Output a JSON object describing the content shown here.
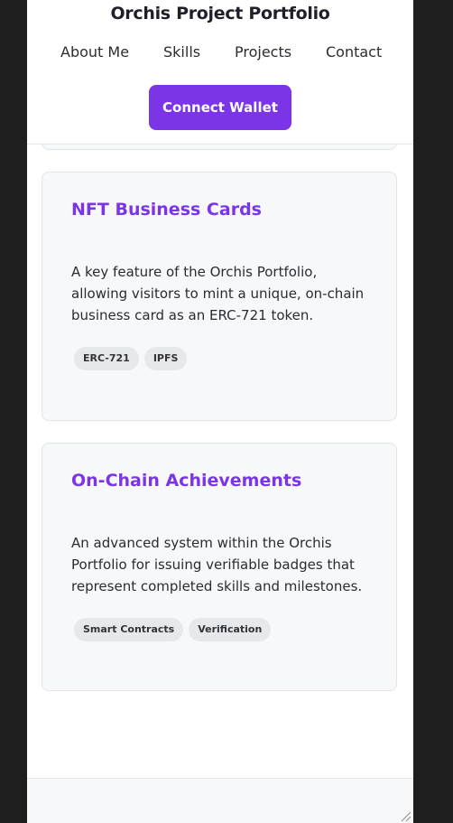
{
  "header": {
    "title": "Orchis Project Portfolio",
    "nav": [
      {
        "label": "About Me"
      },
      {
        "label": "Skills"
      },
      {
        "label": "Projects"
      },
      {
        "label": "Contact"
      }
    ],
    "connect_label": "Connect Wallet"
  },
  "projects": [
    {
      "title": "NFT Business Cards",
      "description": "A key feature of the Orchis Portfolio, allowing visitors to mint a unique, on-chain business card as an ERC-721 token.",
      "tags": [
        "ERC-721",
        "IPFS"
      ]
    },
    {
      "title": "On-Chain Achievements",
      "description": "An advanced system within the Orchis Portfolio for issuing verifiable badges that represent completed skills and milestones.",
      "tags": [
        "Smart Contracts",
        "Verification"
      ]
    }
  ],
  "colors": {
    "accent": "#7b35e6",
    "card_background": "#f7f8fa",
    "tag_background": "#e7e8eb",
    "window_frame": "#1e1e1e"
  }
}
